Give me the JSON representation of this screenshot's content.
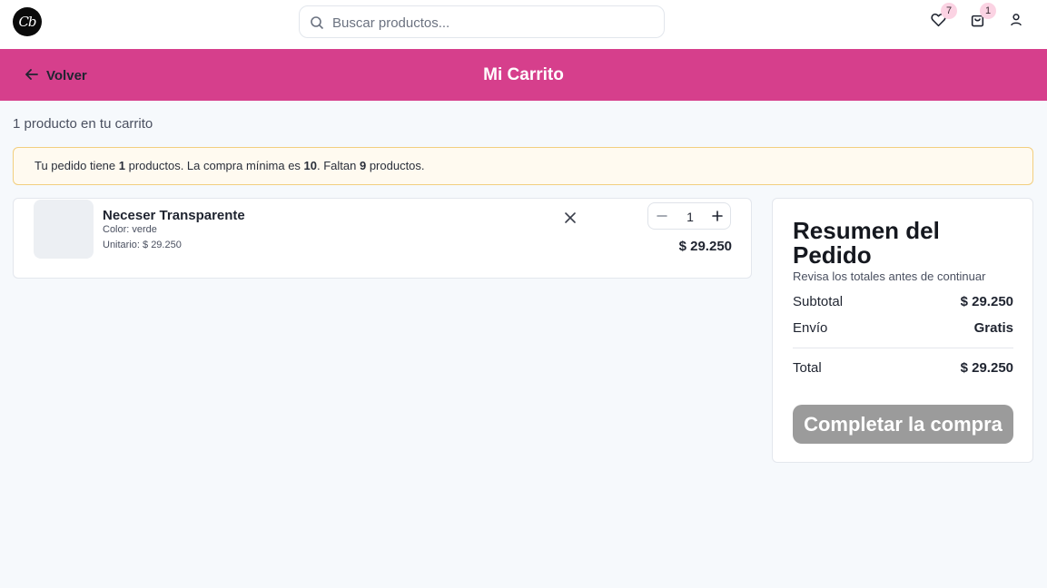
{
  "navbar": {
    "logo_text": "Cb",
    "search_placeholder": "Buscar productos...",
    "wishlist_count": "7",
    "cart_count": "1",
    "icons": [
      "search-icon",
      "heart-icon",
      "shopping-bag-icon",
      "user-icon"
    ]
  },
  "header": {
    "back_label": "Volver",
    "title": "Mi Carrito",
    "background_color": "#d63f8c"
  },
  "cart": {
    "count_text": "1 producto en tu carrito",
    "alert": {
      "prefix": "Tu pedido tiene ",
      "count": "1",
      "middle": " productos. La compra mínima es ",
      "minimum": "10",
      "middle2": ". Faltan ",
      "missing": "9",
      "suffix": " productos."
    },
    "items": [
      {
        "name": "Neceser Transparente",
        "color": "Color: verde",
        "unit_price": "Unitario: $ 29.250",
        "quantity": "1",
        "price": "$ 29.250"
      }
    ]
  },
  "summary": {
    "title": "Resumen del Pedido",
    "subtitle": "Revisa los totales antes de continuar",
    "subtotal_label": "Subtotal",
    "subtotal_value": "$ 29.250",
    "shipping_label": "Envío",
    "shipping_value": "Gratis",
    "total_label": "Total",
    "total_value": "$ 29.250",
    "cta_label": "Completar la compra",
    "cta_color": "#9b9b9b"
  }
}
